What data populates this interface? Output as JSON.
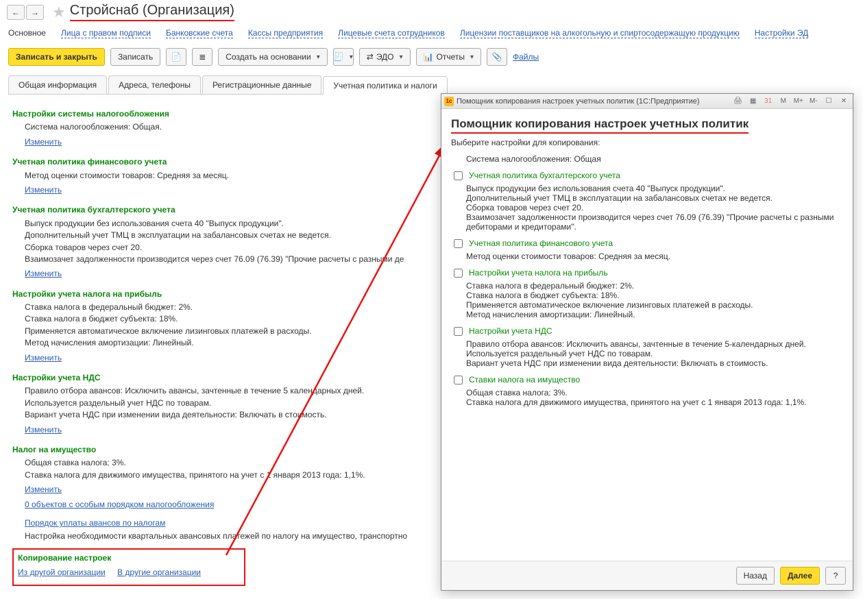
{
  "header": {
    "title": "Стройснаб (Организация)",
    "nav_links": [
      "Основное",
      "Лица с правом подписи",
      "Банковские счета",
      "Кассы предприятия",
      "Лицевые счета сотрудников",
      "Лицензии поставщиков на алкогольную и спиртосодержащую продукцию",
      "Настройки ЭД"
    ]
  },
  "toolbar": {
    "save_close": "Записать и закрыть",
    "save": "Записать",
    "create_based": "Создать на основании",
    "edo": "ЭДО",
    "reports": "Отчеты",
    "files": "Файлы"
  },
  "tabs": [
    "Общая информация",
    "Адреса, телефоны",
    "Регистрационные данные",
    "Учетная политика и налоги"
  ],
  "active_tab": 3,
  "sections": {
    "change": "Изменить",
    "tax_sys": {
      "head": "Настройки системы налогообложения",
      "line": "Система налогообложения: Общая."
    },
    "fin": {
      "head": "Учетная политика финансового учета",
      "line": "Метод оценки стоимости товаров: Средняя за месяц."
    },
    "acc": {
      "head": "Учетная политика бухгалтерского учета",
      "l1": "Выпуск продукции без использования счета 40 \"Выпуск продукции\".",
      "l2": "Дополнительный учет ТМЦ в эксплуатации на забалансовых счетах не ведется.",
      "l3": "Сборка товаров через счет 20.",
      "l4": "Взаимозачет задолженности производится через счет 76.09 (76.39) \"Прочие расчеты с разными де"
    },
    "profit": {
      "head": "Настройки учета налога на прибыль",
      "l1": "Ставка налога в федеральный бюджет: 2%.",
      "l2": "Ставка налога в бюджет субъекта: 18%.",
      "l3": "Применяется автоматическое включение лизинговых платежей в расходы.",
      "l4": "Метод начисления амортизации: Линейный."
    },
    "vat": {
      "head": "Настройки учета НДС",
      "l1": "Правило отбора авансов: Исключить авансы, зачтенные в течение 5 календарных дней.",
      "l2": "Используется раздельный учет НДС по товарам.",
      "l3": "Вариант учета НДС при изменении вида деятельности: Включать в стоимость."
    },
    "prop": {
      "head": "Налог на имущество",
      "l1": "Общая ставка налога: 3%.",
      "l2": "Ставка налога для движимого имущества, принятого на учет с 1 января 2013 года: 1,1%."
    },
    "extra1": "0 объектов с особым порядком налогообложения",
    "extra2": "Порядок уплаты авансов по налогам",
    "extra3": "Настройка необходимости квартальных авансовых платежей по налогу на имущество, транспортно",
    "copy": {
      "head": "Копирование настроек",
      "from": "Из другой организации",
      "to": "В другие организации"
    }
  },
  "dialog": {
    "window_title": "Помощник копирования настроек учетных политик   (1С:Предприятие)",
    "title": "Помощник копирования настроек учетных политик",
    "sub": "Выберите настройки для копирования:",
    "tax_sys": "Система налогообложения: Общая",
    "acc_head": "Учетная политика бухгалтерского учета",
    "acc_l1": "Выпуск продукции без использования счета 40 \"Выпуск продукции\".",
    "acc_l2": "Дополнительный учет ТМЦ в эксплуатации на забалансовых счетах не ведется.",
    "acc_l3": "Сборка товаров через счет 20.",
    "acc_l4": "Взаимозачет задолженности производится через счет 76.09 (76.39) \"Прочие расчеты с разными дебиторами и кредиторами\".",
    "fin_head": "Учетная политика финансового учета",
    "fin_l1": "Метод оценки стоимости товаров: Средняя за месяц.",
    "profit_head": "Настройки учета налога на прибыль",
    "profit_l1": "Ставка налога в федеральный бюджет: 2%.",
    "profit_l2": "Ставка налога в бюджет субъекта: 18%.",
    "profit_l3": "Применяется автоматическое включение лизинговых платежей в расходы.",
    "profit_l4": "Метод начисления амортизации: Линейный.",
    "vat_head": "Настройки учета НДС",
    "vat_l1": "Правило отбора авансов: Исключить авансы, зачтенные в течение 5-календарных дней.",
    "vat_l2": "Используется раздельный учет НДС по товарам.",
    "vat_l3": "Вариант учета НДС при изменении вида деятельности: Включать в стоимость.",
    "prop_head": "Ставки налога на имущество",
    "prop_l1": "Общая ставка налога: 3%.",
    "prop_l2": "Ставка налога для движимого имущества, принятого на учет с 1 января 2013 года: 1,1%.",
    "win_icons": {
      "m": "M",
      "mp": "M+",
      "mm": "M-"
    },
    "back": "Назад",
    "next": "Далее",
    "help": "?"
  }
}
